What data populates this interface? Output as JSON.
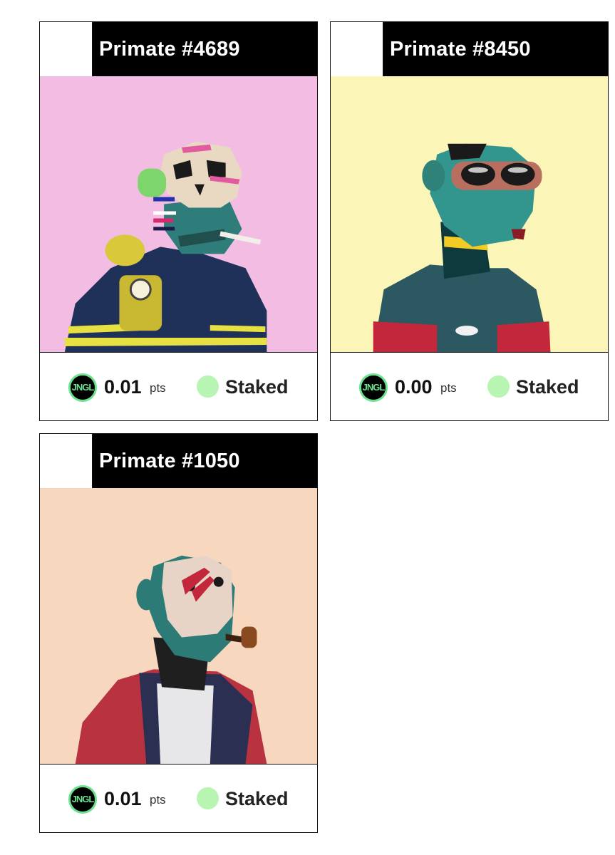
{
  "colors": {
    "status_staked": "#b9f5b2",
    "token_ring": "#6be38f",
    "card_border": "#111111"
  },
  "token_icon_label": "JNGL",
  "cards": [
    {
      "title": "Primate #4689",
      "points": "0.01",
      "unit": "pts",
      "status": "Staked",
      "background": "#f3bde3",
      "art_description_icon": "primate-skull-mask-art"
    },
    {
      "title": "Primate #8450",
      "points": "0.00",
      "unit": "pts",
      "status": "Staked",
      "background": "#fbf6b8",
      "art_description_icon": "primate-goggles-art"
    },
    {
      "title": "Primate #1050",
      "points": "0.01",
      "unit": "pts",
      "status": "Staked",
      "background": "#f8d7bf",
      "art_description_icon": "primate-hockey-mask-art"
    }
  ]
}
